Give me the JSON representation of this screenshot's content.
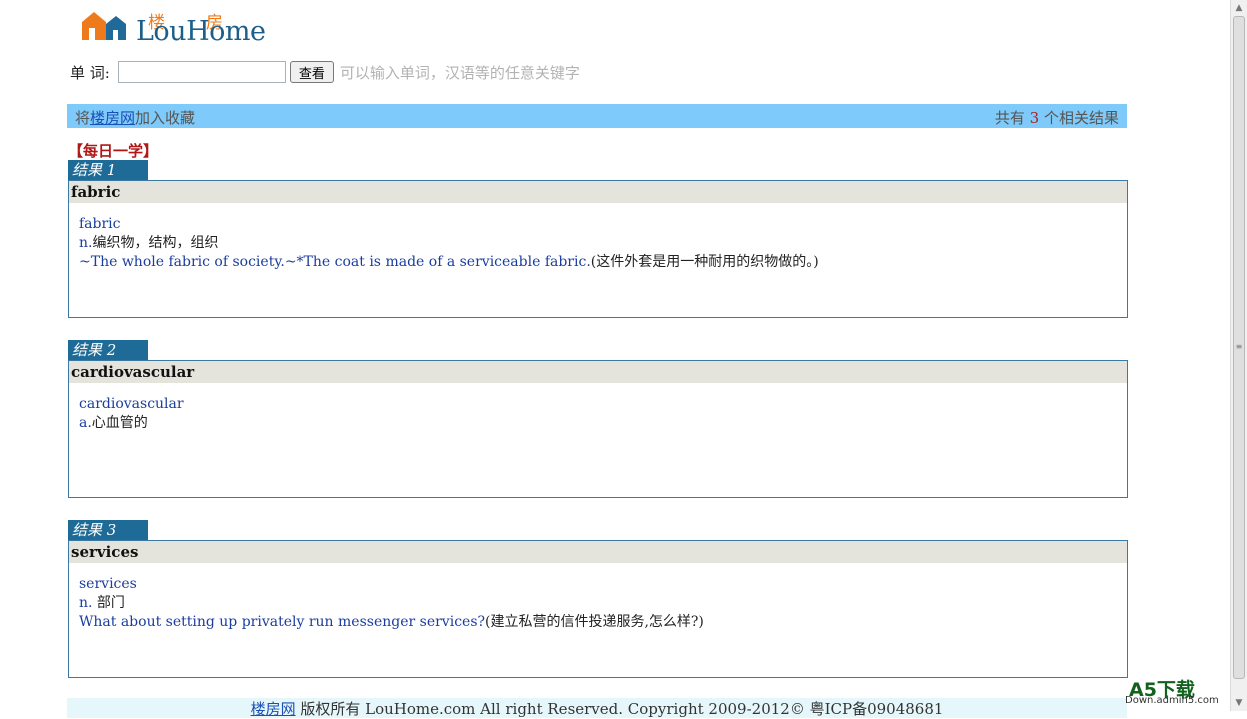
{
  "logo": {
    "brand": "LouHome",
    "cn_left": "楼",
    "cn_right": "房"
  },
  "search": {
    "label": "单 词:",
    "value": "",
    "placeholder": "",
    "button": "查看",
    "hint": "可以输入单词，汉语等的任意关键字"
  },
  "bar": {
    "fav_prefix": "将",
    "fav_link": "楼房网",
    "fav_suffix": "加入收藏",
    "count_prefix": "共有 ",
    "count": "3",
    "count_suffix": " 个相关结果"
  },
  "daily_title": "【每日一学】",
  "results": [
    {
      "tab": "结果 1",
      "head": "fabric",
      "word": "fabric",
      "def_pos": "n.",
      "def_cn": "编织物，结构，组织",
      "ex_en": "~The whole fabric of society.~*The coat is made of a serviceable fabric.",
      "ex_cn": "(这件外套是用一种耐用的织物做的。)"
    },
    {
      "tab": "结果 2",
      "head": "cardiovascular",
      "word": "cardiovascular",
      "def_pos": "a.",
      "def_cn": "心血管的",
      "ex_en": "",
      "ex_cn": ""
    },
    {
      "tab": "结果 3",
      "head": "services",
      "word": "services",
      "def_pos": "n. ",
      "def_cn": "部门",
      "ex_en": "What about setting up privately run messenger services?",
      "ex_cn": "(建立私营的信件投递服务,怎么样?)"
    }
  ],
  "footer": {
    "link": "楼房网",
    "text": " 版权所有 LouHome.com All right Reserved. Copyright 2009-2012© 粤ICP备09048681"
  },
  "watermark": {
    "big": "A5下载",
    "small": "Down.admin5.com"
  },
  "colors": {
    "bar": "#7ecafa",
    "tab": "#1d6b96",
    "head": "#e4e4dc",
    "border": "#3c78a4"
  }
}
